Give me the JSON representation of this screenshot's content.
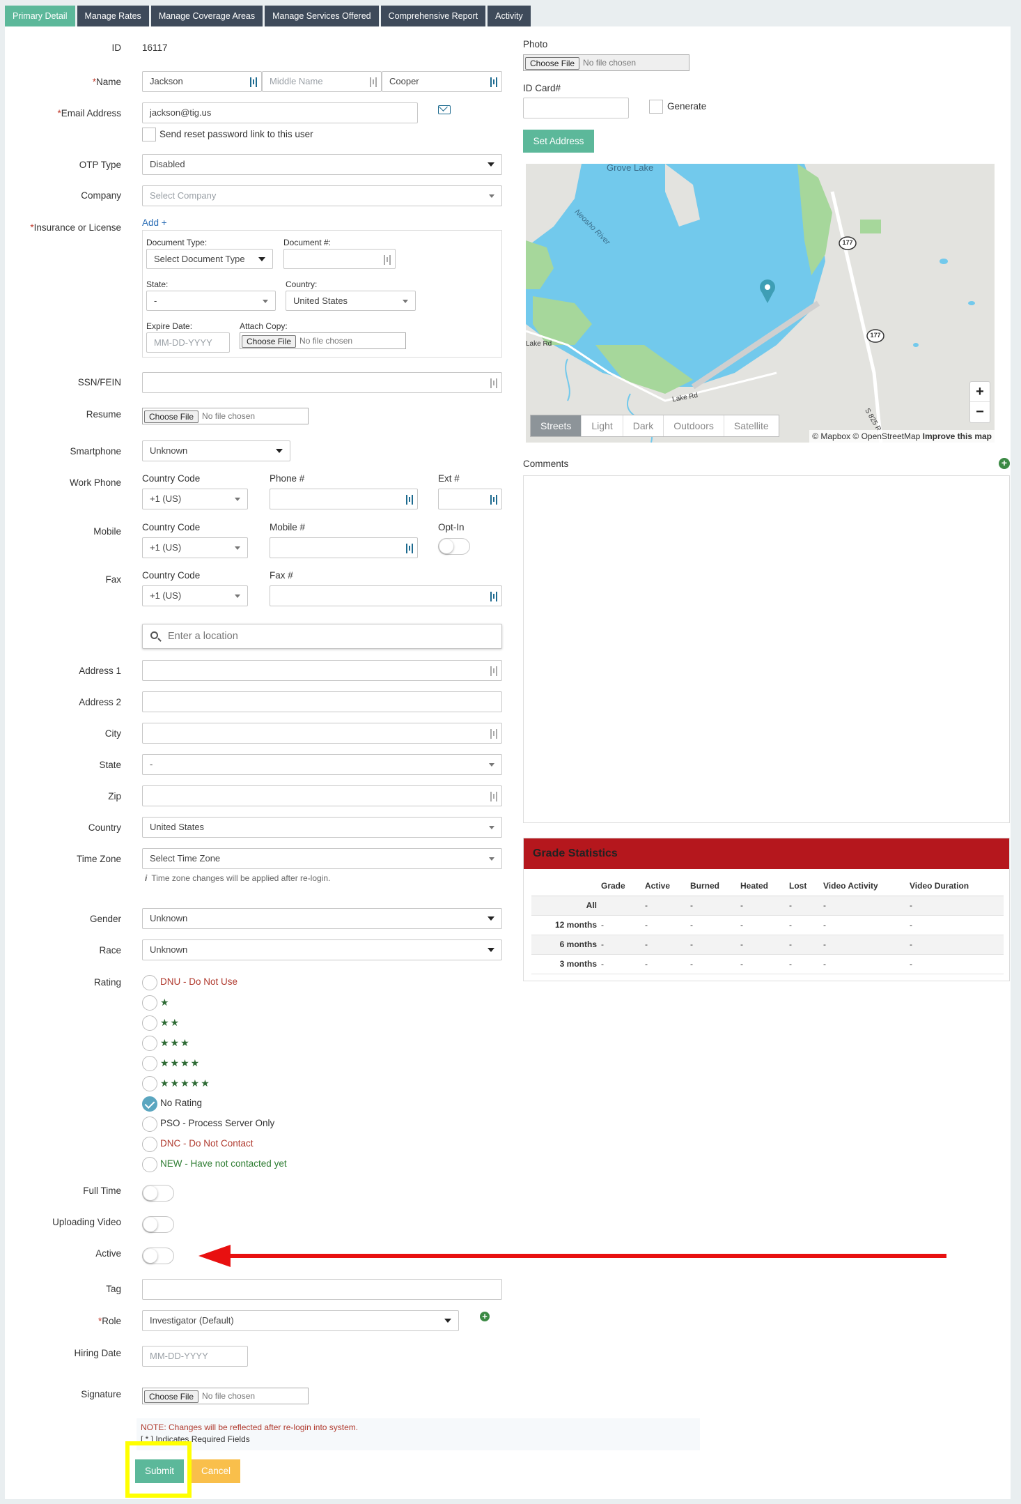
{
  "tabs": [
    "Primary Detail",
    "Manage Rates",
    "Manage Coverage Areas",
    "Manage Services Offered",
    "Comprehensive Report",
    "Activity"
  ],
  "form": {
    "id_label": "ID",
    "id_value": "16117",
    "name_label": "Name",
    "first_name": "Jackson",
    "middle_placeholder": "Middle Name",
    "last_name": "Cooper",
    "email_label": "Email Address",
    "email_value": "jackson@tig.us",
    "reset_link_label": "Send reset password link to this user",
    "otp_label": "OTP Type",
    "otp_value": "Disabled",
    "company_label": "Company",
    "company_placeholder": "Select Company",
    "insurance_label": "Insurance or License",
    "add_link": "Add +",
    "doc_type_label": "Document Type:",
    "doc_type_value": "Select Document Type",
    "doc_num_label": "Document #:",
    "state_label_small": "State:",
    "state_value_small": "-",
    "country_label_small": "Country:",
    "country_value_small": "United States",
    "expire_label": "Expire Date:",
    "expire_placeholder": "MM-DD-YYYY",
    "attach_label": "Attach Copy:",
    "ssn_label": "SSN/FEIN",
    "resume_label": "Resume",
    "smartphone_label": "Smartphone",
    "smartphone_value": "Unknown",
    "work_phone_label": "Work Phone",
    "mobile_label": "Mobile",
    "fax_label": "Fax",
    "country_code_label": "Country Code",
    "country_code_value": "+1 (US)",
    "phone_num_label": "Phone #",
    "ext_label": "Ext #",
    "mobile_num_label": "Mobile #",
    "optin_label": "Opt-In",
    "fax_num_label": "Fax #",
    "location_placeholder": "Enter a location",
    "address1_label": "Address 1",
    "address2_label": "Address 2",
    "city_label": "City",
    "state_label": "State",
    "state_value": "-",
    "zip_label": "Zip",
    "country_label": "Country",
    "country_value": "United States",
    "timezone_label": "Time Zone",
    "timezone_placeholder": "Select Time Zone",
    "timezone_note": "Time zone changes will be applied after re-login.",
    "gender_label": "Gender",
    "gender_value": "Unknown",
    "race_label": "Race",
    "race_value": "Unknown",
    "rating_label": "Rating",
    "rating_options": [
      {
        "label": "DNU - Do Not Use",
        "stars": "",
        "color": "#b03a2e",
        "checked": false
      },
      {
        "label": "",
        "stars": "★",
        "color": "#2e6b35",
        "checked": false
      },
      {
        "label": "",
        "stars": "★★",
        "color": "#2e6b35",
        "checked": false
      },
      {
        "label": "",
        "stars": "★★★",
        "color": "#2e6b35",
        "checked": false
      },
      {
        "label": "",
        "stars": "★★★★",
        "color": "#2e6b35",
        "checked": false
      },
      {
        "label": "",
        "stars": "★★★★★",
        "color": "#2e6b35",
        "checked": false
      },
      {
        "label": "No Rating",
        "stars": "",
        "color": "#333333",
        "checked": true
      },
      {
        "label": "PSO - Process Server Only",
        "stars": "",
        "color": "#333333",
        "checked": false
      },
      {
        "label": "DNC - Do Not Contact",
        "stars": "",
        "color": "#b03a2e",
        "checked": false
      },
      {
        "label": "NEW - Have not contacted yet",
        "stars": "",
        "color": "#2e7d32",
        "checked": false
      }
    ],
    "fulltime_label": "Full Time",
    "uploading_label": "Uploading Video",
    "active_label": "Active",
    "tag_label": "Tag",
    "role_label": "Role",
    "role_value": "Investigator (Default)",
    "hiring_label": "Hiring Date",
    "hiring_placeholder": "MM-DD-YYYY",
    "signature_label": "Signature",
    "note_text": "NOTE: Changes will be reflected after re-login into system.",
    "required_text": "[ * ] Indicates Required Fields",
    "submit_label": "Submit",
    "cancel_label": "Cancel"
  },
  "file_input": {
    "button": "Choose File",
    "status": "No file chosen"
  },
  "right": {
    "photo_label": "Photo",
    "idcard_label": "ID Card#",
    "generate_label": "Generate",
    "set_address_label": "Set Address",
    "comments_label": "Comments"
  },
  "map": {
    "styles": [
      "Streets",
      "Light",
      "Dark",
      "Outdoors",
      "Satellite"
    ],
    "active_style": "Streets",
    "attribution": "© Mapbox © OpenStreetMap",
    "improve": "Improve this map",
    "labels": {
      "lake": "Grove Lake",
      "river": "Neosho River",
      "road1": "Lake Rd",
      "road2": "Lake Rd",
      "road3": "S 825 R",
      "shield": "177"
    },
    "zoom_in": "+",
    "zoom_out": "−"
  },
  "grade_stats": {
    "title": "Grade Statistics",
    "headers": [
      "",
      "Grade",
      "Active",
      "Burned",
      "Heated",
      "Lost",
      "Video Activity",
      "Video Duration"
    ],
    "rows": [
      [
        "All",
        "",
        "-",
        "-",
        "-",
        "-",
        "-",
        "-"
      ],
      [
        "12 months",
        "-",
        "-",
        "-",
        "-",
        "-",
        "-",
        "-"
      ],
      [
        "6 months",
        "-",
        "-",
        "-",
        "-",
        "-",
        "-",
        "-"
      ],
      [
        "3 months",
        "-",
        "-",
        "-",
        "-",
        "-",
        "-",
        "-"
      ]
    ]
  },
  "colors": {
    "accent": "#5cb89a",
    "tab_dark": "#3e4a5a",
    "grade_header": "#b5171d",
    "cancel": "#f9bf4b",
    "highlight": "#ffff00",
    "arrow": "#e81010"
  }
}
